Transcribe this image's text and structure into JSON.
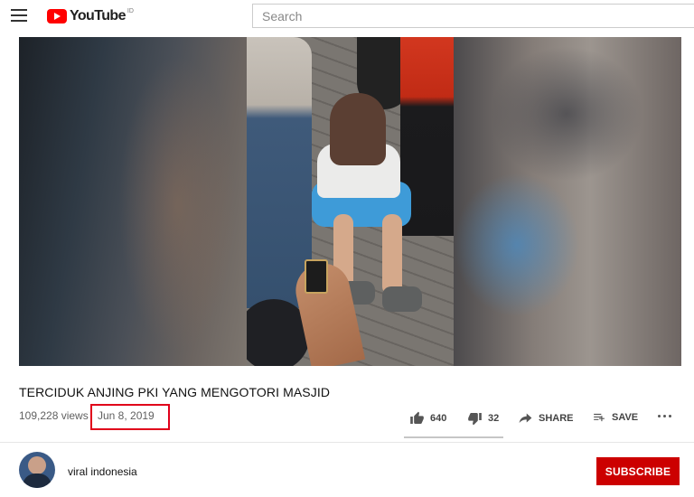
{
  "header": {
    "logo_text": "YouTube",
    "logo_region": "ID",
    "search_placeholder": "Search"
  },
  "video": {
    "title": "TERCIDUK ANJING PKI YANG MENGOTORI MASJID",
    "views": "109,228 views",
    "date": "Jun 8, 2019"
  },
  "actions": {
    "likes": "640",
    "dislikes": "32",
    "share_label": "SHARE",
    "save_label": "SAVE"
  },
  "channel": {
    "name": "viral indonesia",
    "subscribe_label": "SUBSCRIBE"
  },
  "colors": {
    "brand_red": "#ff0000",
    "subscribe_red": "#cc0000",
    "highlight_box": "#e0001a"
  },
  "icons": [
    "menu-icon",
    "youtube-logo-icon",
    "thumbs-up-icon",
    "thumbs-down-icon",
    "share-icon",
    "save-playlist-icon",
    "more-icon"
  ]
}
